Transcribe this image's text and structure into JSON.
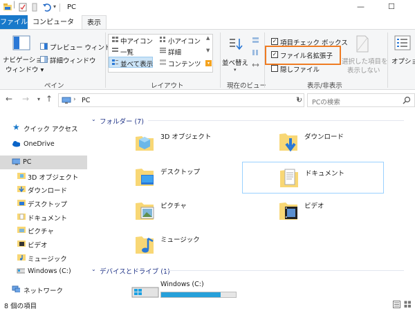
{
  "window": {
    "title": "PC",
    "minimize_glyph": "—",
    "maximize_glyph": "☐"
  },
  "tabs": [
    {
      "label": "ファイル"
    },
    {
      "label": "コンピューター"
    },
    {
      "label": "表示"
    }
  ],
  "ribbon": {
    "pane_group": {
      "navigation_pane_line1": "ナビゲーション",
      "navigation_pane_line2": "ウィンドウ ▾",
      "preview_pane": "プレビュー ウィンドウ",
      "details_pane": "詳細ウィンドウ",
      "label": "ペイン"
    },
    "layout_group": {
      "items": [
        "中アイコン",
        "小アイコン",
        "一覧",
        "詳細",
        "並べて表示",
        "コンテンツ"
      ],
      "label": "レイアウト"
    },
    "current_view_group": {
      "sort_by": "並べ替え",
      "label": "現在のビュー"
    },
    "show_hide_group": {
      "item_checkboxes": "項目チェック ボックス",
      "item_checkboxes_checked": true,
      "file_extensions": "ファイル名拡張子",
      "file_extensions_checked": true,
      "hidden_files": "隠しファイル",
      "hidden_files_checked": false,
      "hide_selected_line1": "選択した項目を",
      "hide_selected_line2": "表示しない",
      "label": "表示/非表示"
    },
    "options": {
      "label": "オプション"
    }
  },
  "address": {
    "path": "PC",
    "search_placeholder": "PCの検索"
  },
  "nav": {
    "items": [
      {
        "label": "クイック アクセス",
        "icon": "star-icon"
      },
      {
        "label": "OneDrive",
        "icon": "cloud-icon"
      },
      {
        "label": "PC",
        "icon": "pc-icon",
        "selected": true
      },
      {
        "label": "3D オブジェクト",
        "icon": "folder-3d-icon"
      },
      {
        "label": "ダウンロード",
        "icon": "downloads-icon"
      },
      {
        "label": "デスクトップ",
        "icon": "desktop-icon"
      },
      {
        "label": "ドキュメント",
        "icon": "documents-icon"
      },
      {
        "label": "ピクチャ",
        "icon": "pictures-icon"
      },
      {
        "label": "ビデオ",
        "icon": "videos-icon"
      },
      {
        "label": "ミュージック",
        "icon": "music-icon"
      },
      {
        "label": "Windows (C:)",
        "icon": "drive-icon"
      },
      {
        "label": "ネットワーク",
        "icon": "network-icon"
      }
    ]
  },
  "content": {
    "folders_header": "フォルダー (7)",
    "folders": [
      {
        "label": "3D オブジェクト"
      },
      {
        "label": "ダウンロード"
      },
      {
        "label": "デスクトップ"
      },
      {
        "label": "ドキュメント",
        "selected": true
      },
      {
        "label": "ピクチャ"
      },
      {
        "label": "ビデオ"
      },
      {
        "label": "ミュージック"
      }
    ],
    "drives_header": "デバイスとドライブ (1)",
    "drive": {
      "label": "Windows (C:)",
      "used_fraction": 0.8
    }
  },
  "status": {
    "item_count": "8 個の項目"
  },
  "colors": {
    "accent": "#1979ca",
    "highlight": "#ef7b22",
    "folder": "#f8d775",
    "drive_fill": "#26a0da",
    "group_header": "#1e3287"
  }
}
